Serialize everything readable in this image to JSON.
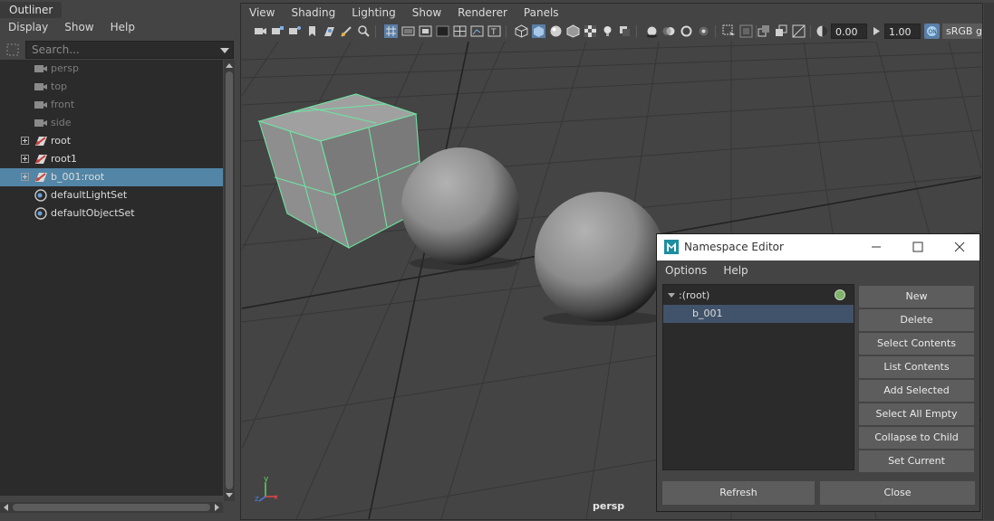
{
  "outliner": {
    "tab_label": "Outliner",
    "menu": [
      "Display",
      "Show",
      "Help"
    ],
    "search_placeholder": "Search...",
    "items": [
      {
        "label": "persp",
        "icon": "camera-icon",
        "state": "dim"
      },
      {
        "label": "top",
        "icon": "camera-icon",
        "state": "dim"
      },
      {
        "label": "front",
        "icon": "camera-icon",
        "state": "dim"
      },
      {
        "label": "side",
        "icon": "camera-icon",
        "state": "dim"
      },
      {
        "label": "root",
        "icon": "joint-icon",
        "state": "normal",
        "expandable": true
      },
      {
        "label": "root1",
        "icon": "joint-icon",
        "state": "normal",
        "expandable": true
      },
      {
        "label": "b_001:root",
        "icon": "joint-icon",
        "state": "selected",
        "expandable": true
      },
      {
        "label": "defaultLightSet",
        "icon": "set-icon",
        "state": "normal"
      },
      {
        "label": "defaultObjectSet",
        "icon": "set-icon",
        "state": "normal"
      }
    ]
  },
  "viewport": {
    "menu": [
      "View",
      "Shading",
      "Lighting",
      "Show",
      "Renderer",
      "Panels"
    ],
    "toolbar": {
      "exposure_value": "0.00",
      "gamma_value": "1.00",
      "color_space": "sRGB gamma"
    },
    "camera_label": "persp",
    "axis": {
      "y": "y",
      "z": "z",
      "x": "x"
    }
  },
  "namespace_editor": {
    "title": "Namespace Editor",
    "menu": [
      "Options",
      "Help"
    ],
    "tree": {
      "root_label": ":(root)",
      "child_label": "b_001"
    },
    "buttons": [
      "New",
      "Delete",
      "Select Contents",
      "List Contents",
      "Add Selected",
      "Select All Empty",
      "Collapse to Child",
      "Set Current"
    ],
    "footer": {
      "refresh": "Refresh",
      "close": "Close"
    }
  },
  "colors": {
    "selection": "#5285a6",
    "wireframe_highlight": "#6fe3a2",
    "grid_line": "#2e2e2e",
    "current_namespace_dot": "#7fb36b"
  }
}
